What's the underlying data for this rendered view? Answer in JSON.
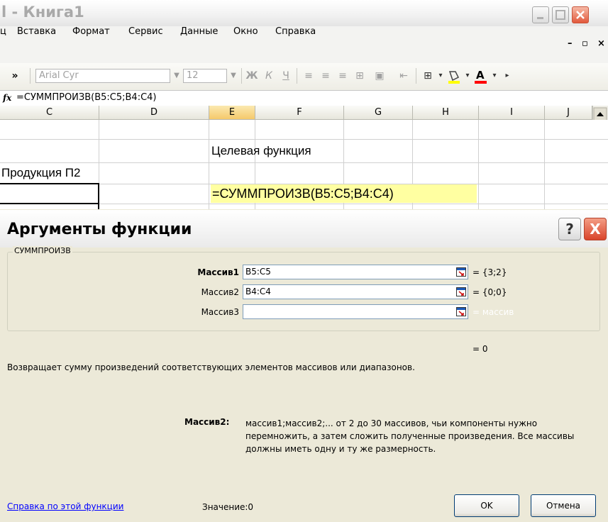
{
  "excel": {
    "window_title": "l - Книга1",
    "menu": [
      "ц",
      "Вставка",
      "Формат",
      "Сервис",
      "Данные",
      "Окно",
      "Справка"
    ],
    "font_name": "Arial Cyr",
    "font_size": "12",
    "toolbar_symbols": {
      "more": "»",
      "bold": "Ж",
      "italic": "К",
      "underline": "Ч"
    },
    "fx_symbol": "fx",
    "formula": "=СУММПРОИЗВ(B5:C5;B4:C4)",
    "columns": [
      "C",
      "D",
      "E",
      "F",
      "G",
      "H",
      "I",
      "J"
    ],
    "selected_column": "E",
    "cells": {
      "target_label": "Целевая функция",
      "product_label": "Продукция П2",
      "formula_cell": "=СУММПРОИЗВ(B5:C5;B4:C4)"
    },
    "colors": {
      "formula_cell_bg": "#ffffa1",
      "selected_header": "#f5c96b"
    }
  },
  "dialog": {
    "title": "Аргументы функции",
    "help_symbol": "?",
    "close_symbol": "X",
    "function_name": "СУММПРОИЗВ",
    "args": [
      {
        "label": "Массив1",
        "value": "B5:C5",
        "result": "= {3;2}",
        "bold": true
      },
      {
        "label": "Массив2",
        "value": "B4:C4",
        "result": "= {0;0}",
        "bold": false
      },
      {
        "label": "Массив3",
        "value": "",
        "result": "= массив",
        "bold": false
      }
    ],
    "total_result": "= 0",
    "description": "Возвращает сумму произведений соответствующих элементов массивов или диапазонов.",
    "arg_help_label": "Массив2:",
    "arg_help_text": "массив1;массив2;... от 2 до 30 массивов, чьи компоненты нужно перемножить, а затем сложить полученные произведения. Все массивы должны иметь одну и ту же размерность.",
    "help_link": "Справка по этой функции",
    "value_label": "Значение:0",
    "ok_label": "OK",
    "cancel_label": "Отмена"
  }
}
